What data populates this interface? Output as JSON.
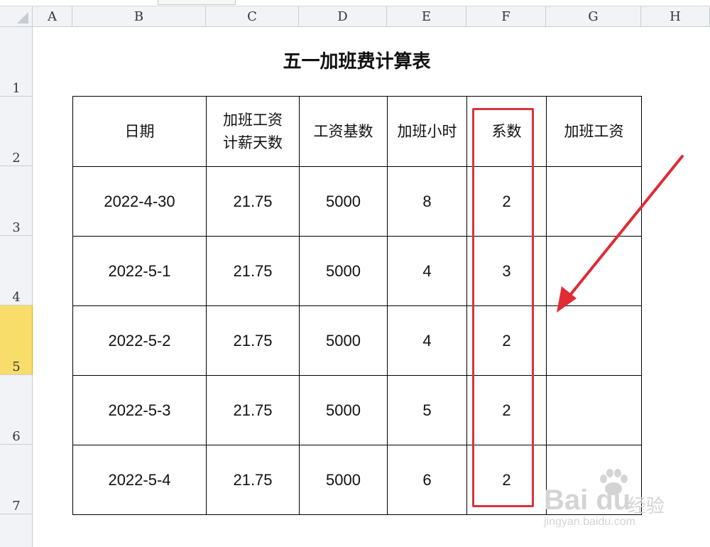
{
  "spreadsheet": {
    "columns": [
      "A",
      "B",
      "C",
      "D",
      "E",
      "F",
      "G",
      "H"
    ],
    "rows": [
      "1",
      "2",
      "3",
      "4",
      "5",
      "6",
      "7"
    ],
    "selected_row": "5"
  },
  "sheet": {
    "title": "五一加班费计算表",
    "headers": {
      "date": "日期",
      "days_line1": "加班工资",
      "days_line2": "计薪天数",
      "base": "工资基数",
      "hours": "加班小时",
      "coef": "系数",
      "pay": "加班工资"
    },
    "records": [
      {
        "date": "2022-4-30",
        "days": "21.75",
        "base": "5000",
        "hours": "8",
        "coef": "2",
        "pay": ""
      },
      {
        "date": "2022-5-1",
        "days": "21.75",
        "base": "5000",
        "hours": "4",
        "coef": "3",
        "pay": ""
      },
      {
        "date": "2022-5-2",
        "days": "21.75",
        "base": "5000",
        "hours": "4",
        "coef": "2",
        "pay": ""
      },
      {
        "date": "2022-5-3",
        "days": "21.75",
        "base": "5000",
        "hours": "5",
        "coef": "2",
        "pay": ""
      },
      {
        "date": "2022-5-4",
        "days": "21.75",
        "base": "5000",
        "hours": "6",
        "coef": "2",
        "pay": ""
      }
    ]
  },
  "annotations": {
    "highlight_color": "#d9323c",
    "arrow_color": "#e02b35",
    "arrow_icon": "arrow-icon"
  },
  "watermark": {
    "logo": "Bai du",
    "text": "经验",
    "url": "jingyan.baidu.com"
  }
}
